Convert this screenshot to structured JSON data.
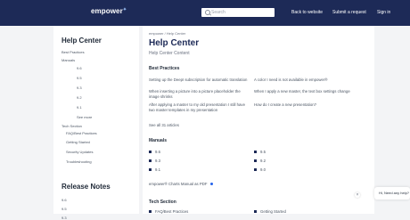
{
  "header": {
    "logo": "empower",
    "search_placeholder": "Search",
    "links": [
      "Back to website",
      "Submit a request",
      "Sign in"
    ]
  },
  "sidebar": {
    "title": "Help Center",
    "items": [
      "Best Practices",
      "Manuals",
      "9.6",
      "9.5",
      "9.3",
      "9.2",
      "9.1",
      "See more",
      "Tech Section",
      "FAQ/Best Practices",
      "Getting Started",
      "Security Updates",
      "Troubleshooting"
    ],
    "release_title": "Release Notes",
    "release_items": [
      "9.6",
      "9.5",
      "9.3"
    ]
  },
  "main": {
    "breadcrumb": "empower / Help Center",
    "title": "Help Center",
    "subtitle": "Help Center Content",
    "best_practices": {
      "heading": "Best Practices",
      "articles": [
        "Setting up the DeepI subscription for automatic translation",
        "A color I need is not available in empower®",
        "When inserting a picture into a picture placeholder the image shrinks",
        "When I apply a new master, the text box settings change",
        "After applying a master to my old presentation I still have two master templates in my presentation",
        "How do I create a new presentation?"
      ],
      "see_all": "See all 31 articles"
    },
    "manuals": {
      "heading": "Manuals",
      "items": [
        "9.6",
        "9.5",
        "9.3",
        "9.2",
        "9.1",
        "9.0"
      ],
      "pdf": "empower® Charts Manual as PDF"
    },
    "tech": {
      "heading": "Tech Section",
      "items": [
        "FAQ/Best Practices",
        "Getting Started"
      ]
    }
  },
  "chat": {
    "label": "Hi, Need any help?",
    "close": "×"
  }
}
